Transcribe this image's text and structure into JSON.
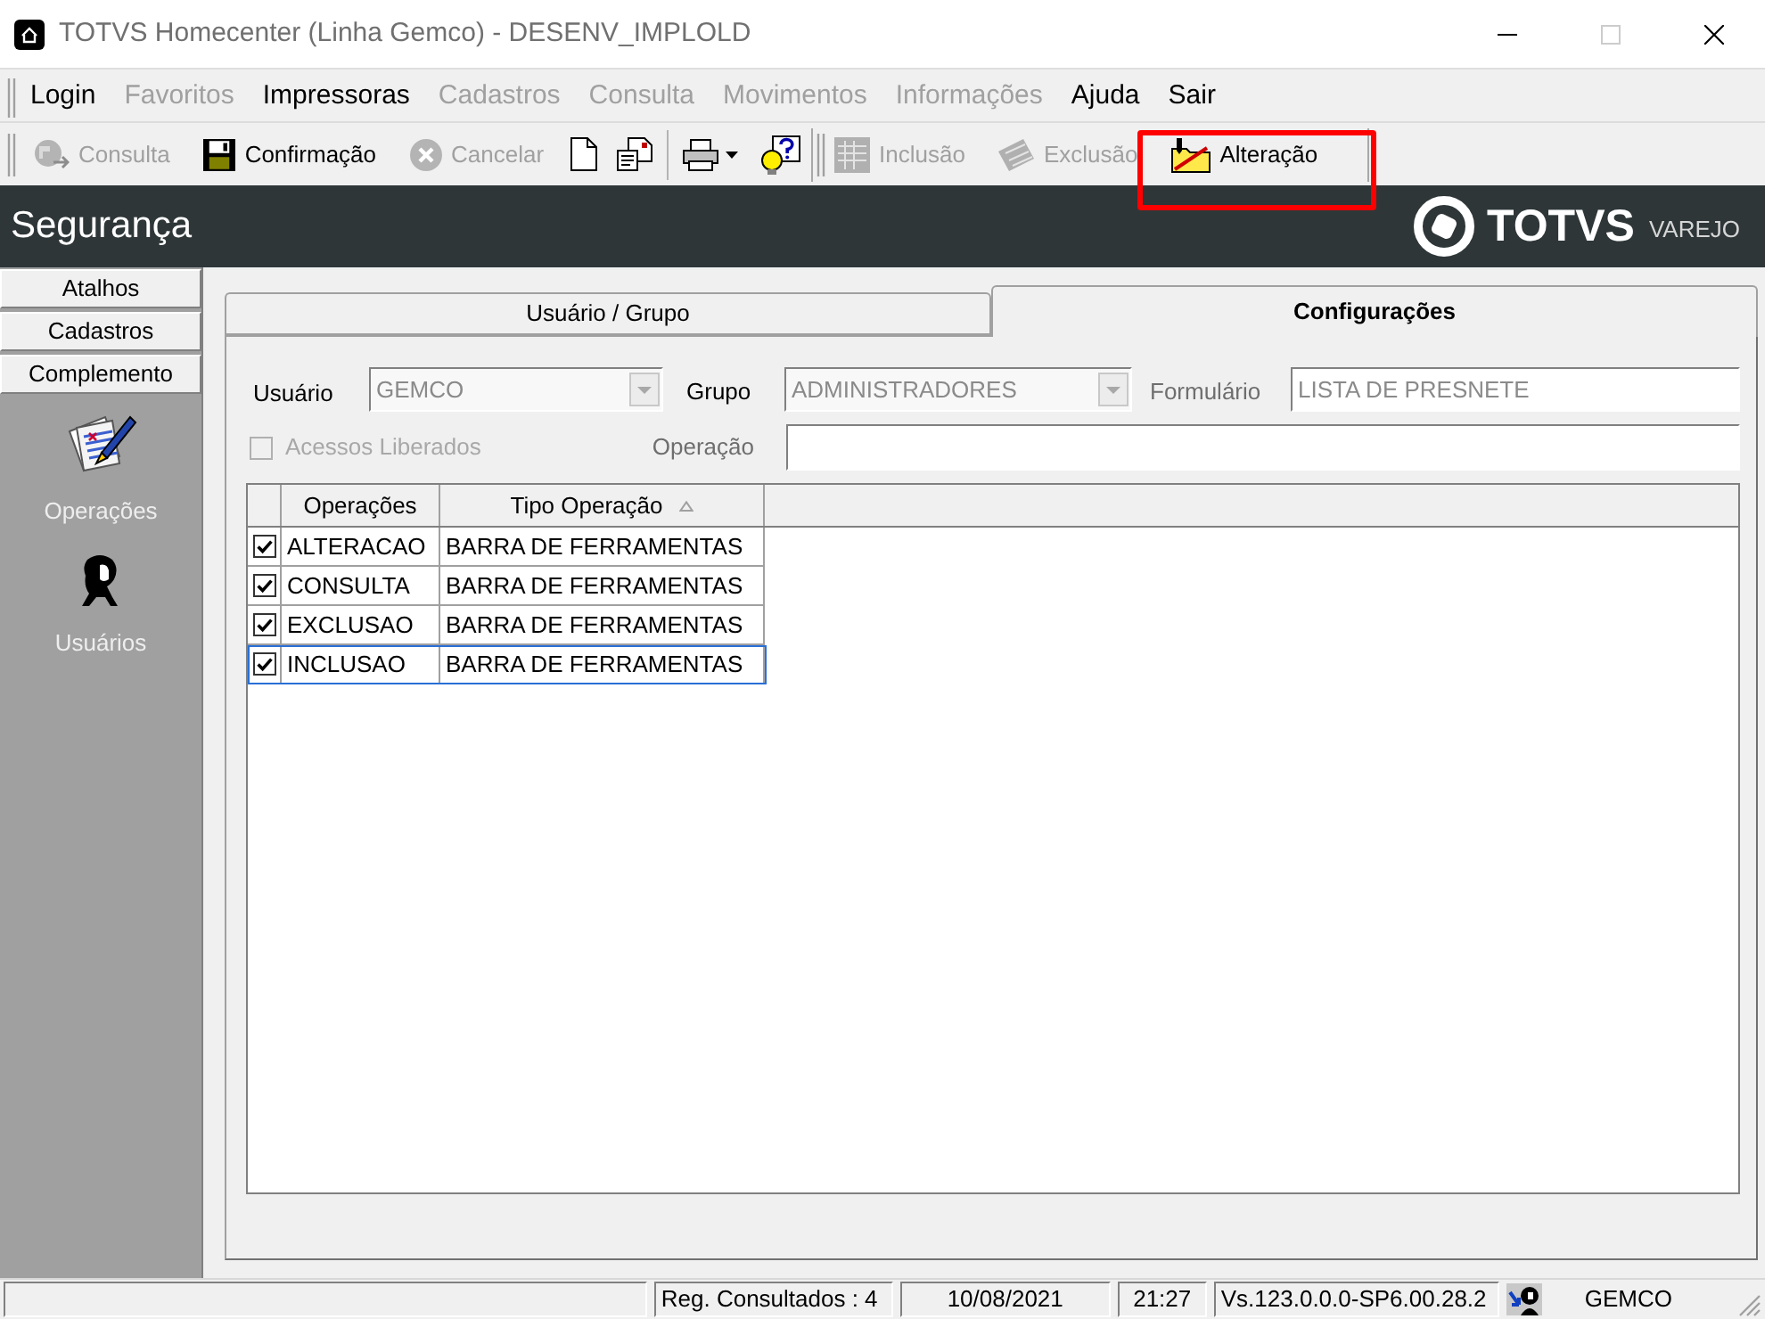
{
  "window": {
    "title": "TOTVS Homecenter (Linha Gemco) - DESENV_IMPLOLD",
    "controls": [
      {
        "kind": "minimize",
        "disabled": false
      },
      {
        "kind": "maximize",
        "disabled": true
      },
      {
        "kind": "close",
        "disabled": false
      }
    ]
  },
  "menu": [
    {
      "label": "Login",
      "disabled": false
    },
    {
      "label": "Favoritos",
      "disabled": true
    },
    {
      "label": "Impressoras",
      "disabled": false
    },
    {
      "label": "Cadastros",
      "disabled": true
    },
    {
      "label": "Consulta",
      "disabled": true
    },
    {
      "label": "Movimentos",
      "disabled": true
    },
    {
      "label": "Informações",
      "disabled": true
    },
    {
      "label": "Ajuda",
      "disabled": false
    },
    {
      "label": "Sair",
      "disabled": false
    }
  ],
  "toolbars": [
    {
      "groups": [
        {
          "items": [
            {
              "kind": "query",
              "label": "Consulta",
              "disabled": true
            },
            {
              "kind": "confirm",
              "label": "Confirmação",
              "disabled": false
            },
            {
              "kind": "cancel",
              "label": "Cancelar",
              "disabled": true
            },
            {
              "kind": "new",
              "disabled": false
            },
            {
              "kind": "open",
              "disabled": false
            }
          ]
        },
        {
          "items": [
            {
              "kind": "print",
              "disabled": false
            },
            {
              "kind": "help",
              "disabled": false
            }
          ]
        }
      ]
    },
    {
      "groups": [
        {
          "items": [
            {
              "kind": "insert",
              "label": "Inclusão",
              "disabled": true
            },
            {
              "kind": "delete",
              "label": "Exclusão",
              "disabled": true
            },
            {
              "kind": "edit",
              "label": "Alteração",
              "disabled": false,
              "highlighted": true
            }
          ]
        }
      ]
    }
  ],
  "header": {
    "title": "Segurança",
    "brand": {
      "name": "TOTVS",
      "tagline": "VAREJO"
    }
  },
  "sidebar": {
    "sections": [
      {
        "label": "Atalhos"
      },
      {
        "label": "Cadastros"
      },
      {
        "label": "Complemento",
        "items": [
          {
            "kind": "operations",
            "label": "Operações"
          },
          {
            "kind": "users",
            "label": "Usuários"
          }
        ]
      }
    ]
  },
  "tabs": [
    {
      "label": "Usuário / Grupo",
      "selected": false
    },
    {
      "label": "Configurações",
      "selected": true
    }
  ],
  "form": {
    "user": {
      "label": "Usuário",
      "value": "GEMCO",
      "disabled": true
    },
    "group": {
      "label": "Grupo",
      "value": "ADMINISTRADORES",
      "disabled": true
    },
    "form_name": {
      "label": "Formulário",
      "value": "LISTA DE PRESNETE",
      "disabled": true
    },
    "free_access": {
      "label": "Acessos Liberados",
      "checked": false,
      "disabled": true
    },
    "operation": {
      "label": "Operação"
    }
  },
  "grid": {
    "columns": [
      {
        "label": "Operações",
        "sorted": false
      },
      {
        "label": "Tipo Operação",
        "sorted": true
      }
    ],
    "rows": [
      {
        "checked": true,
        "selected": false,
        "cells": [
          "ALTERACAO",
          "BARRA DE FERRAMENTAS"
        ]
      },
      {
        "checked": true,
        "selected": false,
        "cells": [
          "CONSULTA",
          "BARRA DE FERRAMENTAS"
        ]
      },
      {
        "checked": true,
        "selected": false,
        "cells": [
          "EXCLUSAO",
          "BARRA DE FERRAMENTAS"
        ]
      },
      {
        "checked": true,
        "selected": true,
        "cells": [
          "INCLUSAO",
          "BARRA DE FERRAMENTAS"
        ]
      }
    ]
  },
  "status_bar": {
    "panels": [
      {
        "kind": "text",
        "text": "Reg. Consultados : 4"
      },
      {
        "kind": "text",
        "text": "10/08/2021"
      },
      {
        "kind": "text",
        "text": "21:27"
      },
      {
        "kind": "text",
        "text": "Vs.123.0.0.0-SP6.00.28.2"
      },
      {
        "kind": "user",
        "text": "GEMCO"
      }
    ]
  }
}
